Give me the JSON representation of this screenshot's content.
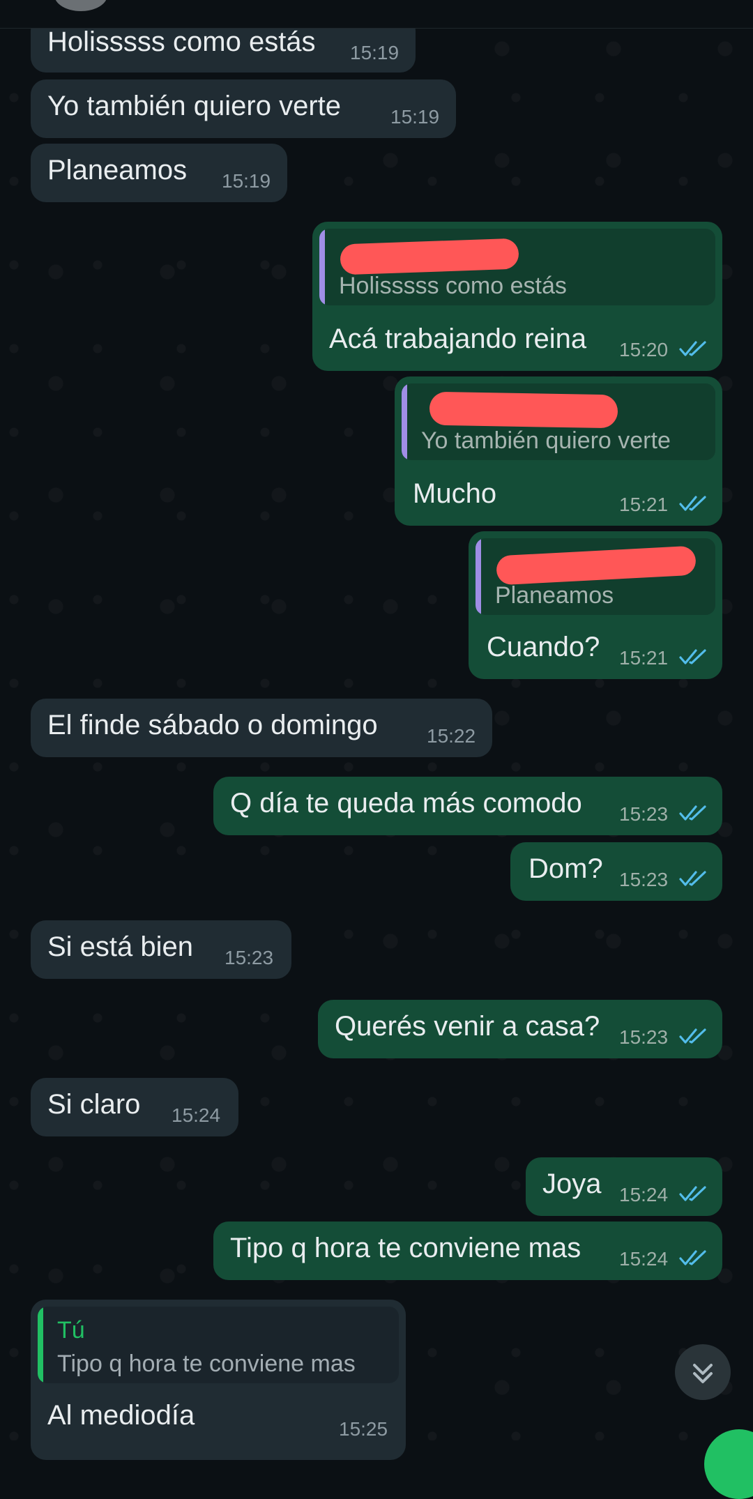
{
  "colors": {
    "background": "#0b1014",
    "incoming_bubble": "#202c33",
    "outgoing_bubble": "#144d37",
    "quote_bar_outgoing": "#a08ee6",
    "quote_bar_incoming": "#21c063",
    "read_ticks": "#53bdeb",
    "redaction": "#ff5757"
  },
  "icons": {
    "read_receipt": "double-check-icon",
    "scroll_down": "double-chevron-down-icon"
  },
  "messages": [
    {
      "text": "Holisssss como estás",
      "time": "15:19"
    },
    {
      "text": "Yo también quiero verte",
      "time": "15:19"
    },
    {
      "text": "Planeamos",
      "time": "15:19"
    },
    {
      "text": "Acá trabajando reina",
      "time": "15:20",
      "quote_text": "Holisssss como estás"
    },
    {
      "text": "Mucho",
      "time": "15:21",
      "quote_text": "Yo también quiero verte"
    },
    {
      "text": "Cuando?",
      "time": "15:21",
      "quote_text": "Planeamos"
    },
    {
      "text": "El finde sábado o domingo",
      "time": "15:22"
    },
    {
      "text": "Q día te queda más comodo",
      "time": "15:23"
    },
    {
      "text": "Dom?",
      "time": "15:23"
    },
    {
      "text": "Si está bien",
      "time": "15:23"
    },
    {
      "text": "Querés venir a casa?",
      "time": "15:23"
    },
    {
      "text": "Si claro",
      "time": "15:24"
    },
    {
      "text": "Joya",
      "time": "15:24"
    },
    {
      "text": "Tipo q hora te conviene mas",
      "time": "15:24"
    },
    {
      "text": "Al mediodía",
      "time": "15:25",
      "quote_name": "Tú",
      "quote_text": "Tipo q hora te conviene mas"
    }
  ]
}
